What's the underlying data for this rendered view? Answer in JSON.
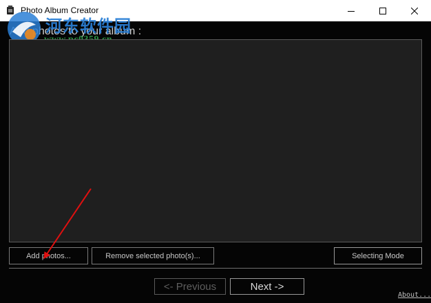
{
  "window": {
    "title": "Photo Album Creator",
    "controls": {
      "minimize": "minimize-icon",
      "maximize": "maximize-icon",
      "close": "close-icon"
    }
  },
  "watermark": {
    "site_name": "河东软件园",
    "url": "www.pc0359.cn"
  },
  "main": {
    "prompt": "Add photos to your album :"
  },
  "buttons": {
    "add_photos": "Add photos...",
    "remove_selected": "Remove selected photo(s)...",
    "selecting_mode": "Selecting Mode",
    "previous": "<- Previous",
    "next": "Next ->"
  },
  "footer": {
    "about": "About..."
  },
  "colors": {
    "window_bg": "#050505",
    "photo_area_bg": "#1f1f1f",
    "annotation_arrow": "#e01010",
    "watermark_blue": "#2a7fd6",
    "watermark_green": "#2fa34a"
  }
}
